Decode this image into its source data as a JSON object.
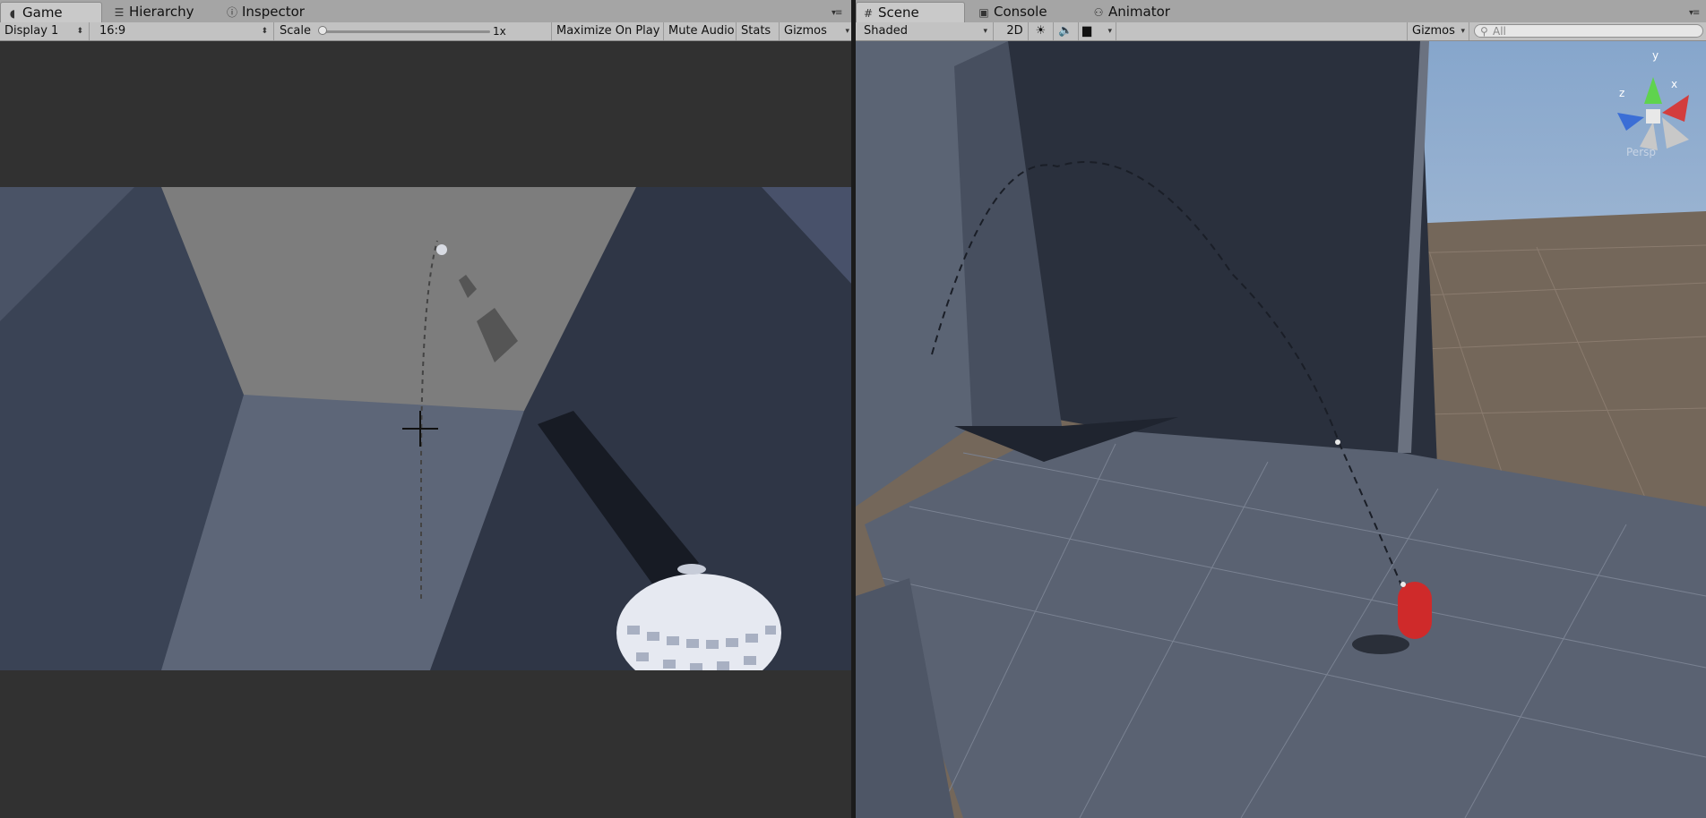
{
  "game": {
    "tabs": [
      {
        "label": "Game",
        "icon": "pacman-icon"
      },
      {
        "label": "Hierarchy",
        "icon": "list-icon"
      },
      {
        "label": "Inspector",
        "icon": "info-icon"
      }
    ],
    "toolbar": {
      "display": "Display 1",
      "aspect": "16:9",
      "scale_label": "Scale",
      "scale_value": "1x",
      "scale_level": 0,
      "maximize_on_play": "Maximize On Play",
      "mute_audio": "Mute Audio",
      "stats": "Stats",
      "gizmos": "Gizmos"
    }
  },
  "scene": {
    "tabs": [
      {
        "label": "Scene",
        "icon": "grid-icon"
      },
      {
        "label": "Console",
        "icon": "console-icon"
      },
      {
        "label": "Animator",
        "icon": "animator-icon"
      }
    ],
    "toolbar": {
      "draw_mode": "Shaded",
      "mode_2d": "2D",
      "gizmos": "Gizmos",
      "search_placeholder": "All"
    },
    "orientation_gizmo": {
      "axes": [
        "y",
        "x",
        "z"
      ],
      "projection": "Persp"
    }
  },
  "colors": {
    "sky": "#9db6d2",
    "ground": "#78685a",
    "wall_dark": "#2b313d",
    "player_red": "#d42a2a",
    "tabbar": "#a5a5a5",
    "toolbar": "#c2c2c2"
  }
}
